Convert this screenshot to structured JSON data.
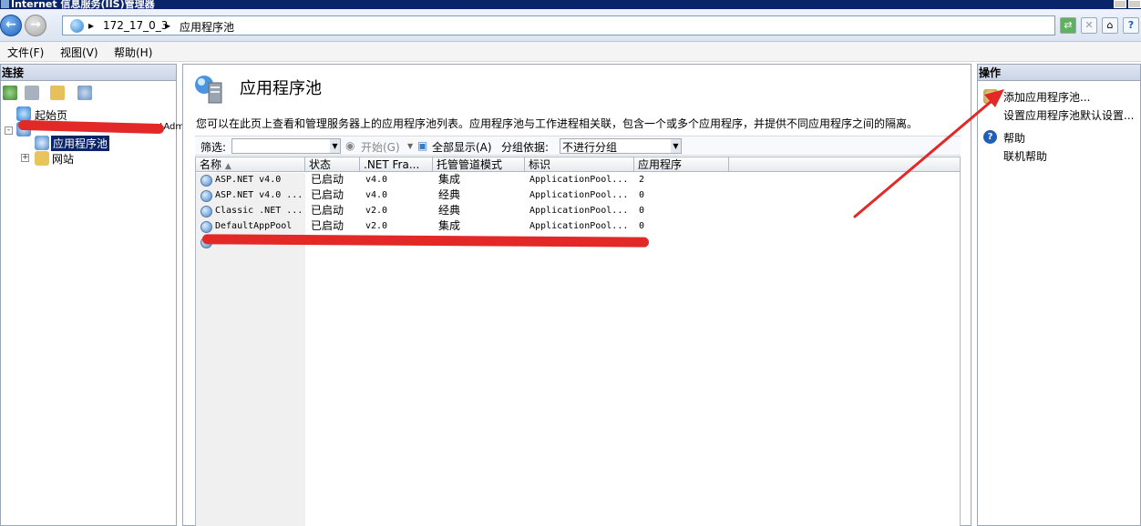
{
  "window": {
    "title": "Internet 信息服务(IIS)管理器"
  },
  "address": {
    "crumbs": [
      "172_17_0_3",
      "应用程序池"
    ]
  },
  "menu": {
    "items": [
      "文件(F)",
      "视图(V)",
      "帮助(H)"
    ]
  },
  "connections": {
    "header": "连接",
    "tree": {
      "start_page": "起始页",
      "server_suffix": "_\\Adm",
      "app_pools": "应用程序池",
      "sites": "网站"
    }
  },
  "center": {
    "title": "应用程序池",
    "description": "您可以在此页上查看和管理服务器上的应用程序池列表。应用程序池与工作进程相关联，包含一个或多个应用程序，并提供不同应用程序之间的隔离。",
    "filter": {
      "label": "筛选:",
      "start": "开始(G)",
      "show_all": "全部显示(A)",
      "group_label": "分组依据:",
      "group_value": "不进行分组"
    },
    "columns": [
      "名称",
      "状态",
      ".NET Fra...",
      "托管管道模式",
      "标识",
      "应用程序"
    ],
    "rows": [
      {
        "name": "ASP.NET v4.0",
        "status": "已启动",
        "net": "v4.0",
        "pipeline": "集成",
        "identity": "ApplicationPool...",
        "apps": "2"
      },
      {
        "name": "ASP.NET v4.0 ...",
        "status": "已启动",
        "net": "v4.0",
        "pipeline": "经典",
        "identity": "ApplicationPool...",
        "apps": "0"
      },
      {
        "name": "Classic .NET ...",
        "status": "已启动",
        "net": "v2.0",
        "pipeline": "经典",
        "identity": "ApplicationPool...",
        "apps": "0"
      },
      {
        "name": "DefaultAppPool",
        "status": "已启动",
        "net": "v2.0",
        "pipeline": "集成",
        "identity": "ApplicationPool...",
        "apps": "0"
      }
    ]
  },
  "actions": {
    "header": "操作",
    "add_pool": "添加应用程序池...",
    "set_defaults": "设置应用程序池默认设置...",
    "help": "帮助",
    "online_help": "联机帮助"
  },
  "colors": {
    "titlebar": "#0a246a",
    "redaction": "#e32828",
    "selection": "#0a246a"
  }
}
